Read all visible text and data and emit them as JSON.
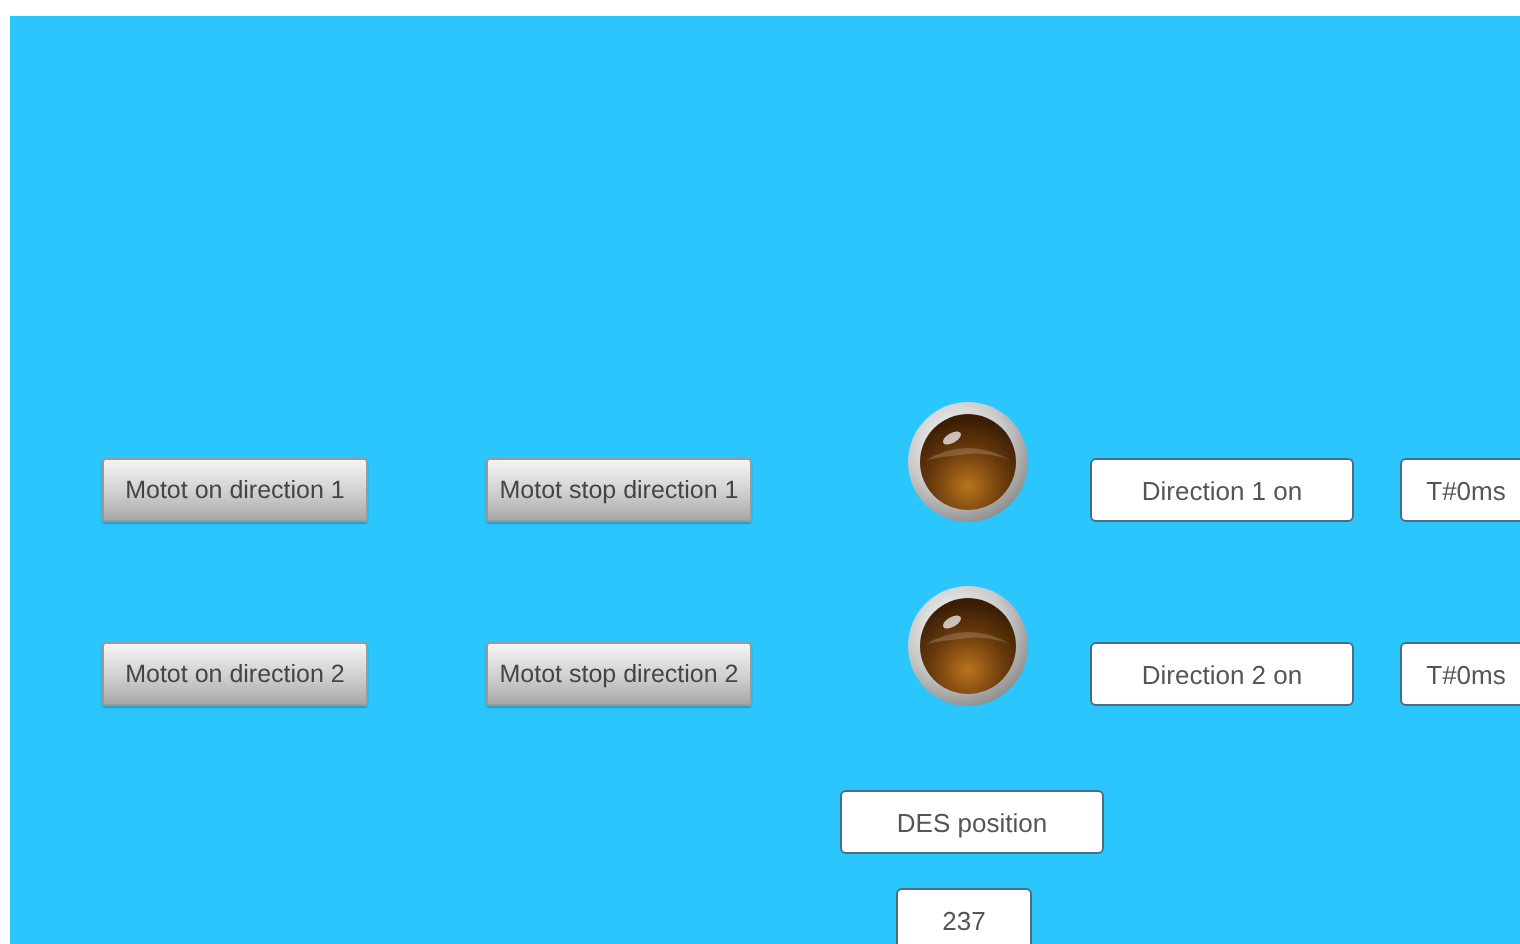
{
  "rows": [
    {
      "on_button": "Motot on direction 1",
      "stop_button": "Motot stop direction 1",
      "lamp": {
        "on": false
      },
      "status": "Direction 1 on",
      "timer": "T#0ms"
    },
    {
      "on_button": "Motot on direction 2",
      "stop_button": "Motot stop direction 2",
      "lamp": {
        "on": false
      },
      "status": "Direction 2 on",
      "timer": "T#0ms"
    }
  ],
  "position": {
    "label": "DES position",
    "value": "237"
  }
}
